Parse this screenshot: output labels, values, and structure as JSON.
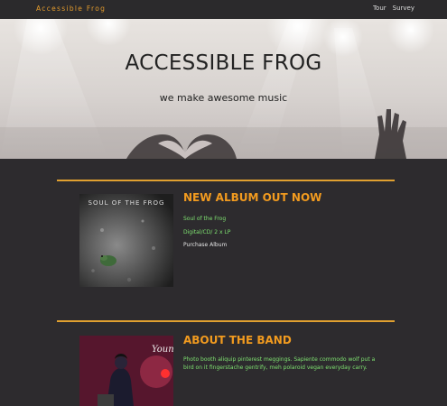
{
  "navbar": {
    "brand": "Accessible Frog",
    "links": [
      "Tour",
      "Survey"
    ]
  },
  "hero": {
    "title": "ACCESSIBLE FROG",
    "subtitle": "we make awesome music"
  },
  "album": {
    "heading": "NEW ALBUM OUT NOW",
    "cover_text": "SOUL OF THE FROG",
    "name": "Soul of the Frog",
    "formats": "Digital/CD/ 2 x LP",
    "purchase_label": "Purchase Album"
  },
  "band": {
    "heading": "ABOUT THE BAND",
    "photo_text": "Young Frog",
    "description": "Photo booth aliquip pinterest meggings. Sapiente commodo wolf put a bird on it fingerstache gentrify, meh polaroid vegan everyday carry."
  },
  "colors": {
    "accent": "#f29b1f",
    "green_text": "#7ee070",
    "background": "#2d2b2e"
  }
}
